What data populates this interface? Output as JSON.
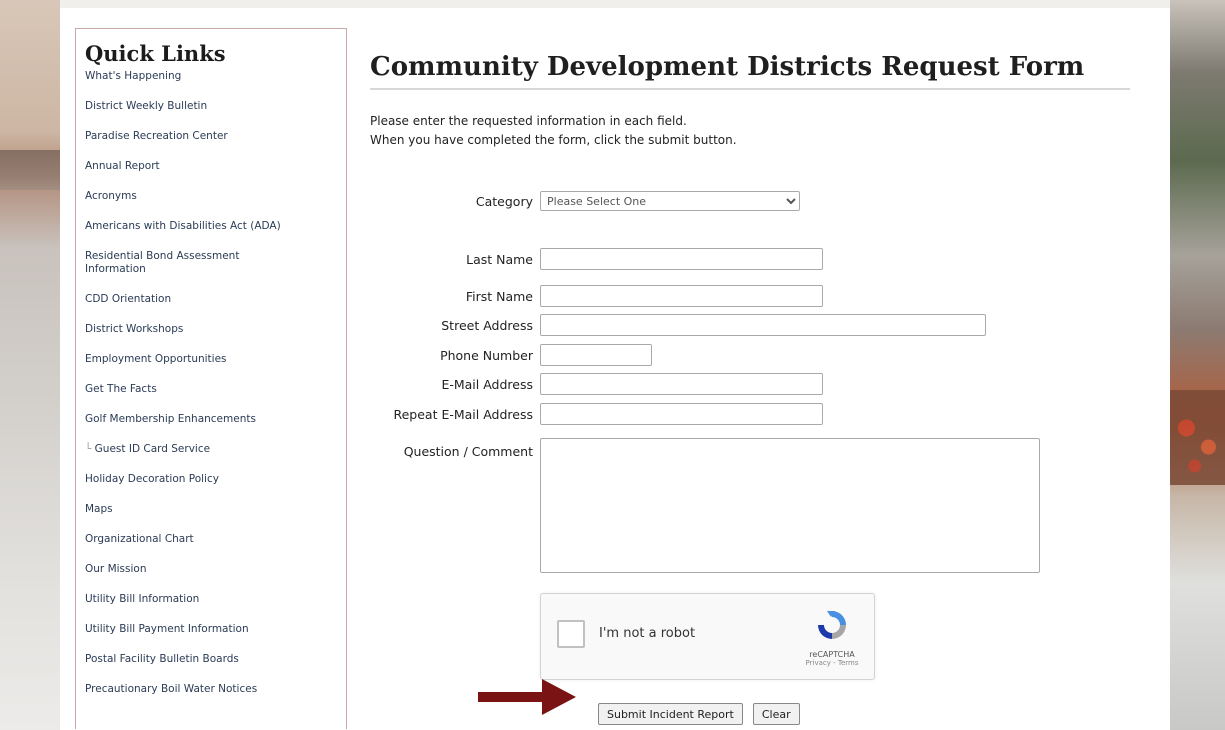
{
  "sidebar": {
    "title": "Quick Links",
    "items": [
      {
        "label": "What's Happening"
      },
      {
        "label": "District Weekly Bulletin"
      },
      {
        "label": "Paradise Recreation Center"
      },
      {
        "label": "Annual Report"
      },
      {
        "label": "Acronyms"
      },
      {
        "label": "Americans with Disabilities Act (ADA)"
      },
      {
        "label": "Residential Bond Assessment Information"
      },
      {
        "label": "CDD Orientation"
      },
      {
        "label": "District Workshops"
      },
      {
        "label": "Employment Opportunities"
      },
      {
        "label": "Get The Facts"
      },
      {
        "label": "Golf Membership Enhancements"
      },
      {
        "label": "Guest ID Card Service"
      },
      {
        "label": "Holiday Decoration Policy"
      },
      {
        "label": "Maps"
      },
      {
        "label": "Organizational Chart"
      },
      {
        "label": "Our Mission"
      },
      {
        "label": "Utility Bill Information"
      },
      {
        "label": "Utility Bill Payment Information"
      },
      {
        "label": "Postal Facility Bulletin Boards"
      },
      {
        "label": "Precautionary Boil Water Notices"
      }
    ]
  },
  "main": {
    "title": "Community Development Districts Request Form",
    "instructions": [
      "Please enter the requested information in each field.",
      "When you have completed the form, click the submit button."
    ]
  },
  "form": {
    "category": {
      "label": "Category",
      "selected": "Please Select One"
    },
    "last_name": {
      "label": "Last Name",
      "value": ""
    },
    "first_name": {
      "label": "First Name",
      "value": ""
    },
    "street_address": {
      "label": "Street Address",
      "value": ""
    },
    "phone_number": {
      "label": "Phone Number",
      "value": ""
    },
    "email": {
      "label": "E-Mail Address",
      "value": ""
    },
    "repeat_email": {
      "label": "Repeat E-Mail Address",
      "value": ""
    },
    "comment": {
      "label": "Question / Comment",
      "value": ""
    }
  },
  "captcha": {
    "label": "I'm not a robot",
    "brand": "reCAPTCHA",
    "links": "Privacy - Terms"
  },
  "buttons": {
    "submit": "Submit Incident Report",
    "clear": "Clear"
  },
  "colors": {
    "arrow": "#7a1414",
    "sidebar_border": "#c9a9a9",
    "link_text": "#2a3b55"
  },
  "icons": [
    "recaptcha-logo-icon",
    "dropdown-chevron-icon",
    "red-arrow-icon"
  ]
}
